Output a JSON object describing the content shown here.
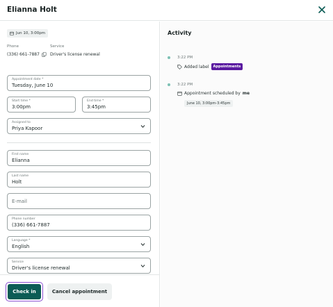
{
  "header": {
    "title": "Elianna Holt"
  },
  "summary": {
    "date_chip": "Jun 10, 3:00pm",
    "phone_label": "Phone",
    "phone_value": "(336) 661-7887",
    "service_label": "Service",
    "service_value": "Driver's license renewal"
  },
  "form": {
    "appointment_date": {
      "label": "Appointment date *",
      "value": "Tuesday, June 10"
    },
    "start_time": {
      "label": "Start time *",
      "value": "3:00pm"
    },
    "end_time": {
      "label": "End time *",
      "value": "3:45pm"
    },
    "assigned_to": {
      "label": "Assigned to",
      "value": "Priya Kapoor"
    },
    "first_name": {
      "label": "First name",
      "value": "Elianna"
    },
    "last_name": {
      "label": "Last name",
      "value": "Holt"
    },
    "email": {
      "placeholder": "E-mail"
    },
    "phone_number": {
      "label": "Phone number",
      "value": "(336) 661-7887"
    },
    "language": {
      "label": "Language *",
      "value": "English"
    },
    "service": {
      "label": "Service",
      "value": "Driver's license renewal"
    }
  },
  "footer": {
    "check_in_label": "Check in",
    "cancel_label": "Cancel appointment"
  },
  "activity": {
    "title": "Activity",
    "items": [
      {
        "time": "3:22 PM",
        "text": "Added label",
        "badge": "Appointments",
        "icon": "tag-icon"
      },
      {
        "time": "3:22 PM",
        "text": "Appointment scheduled by",
        "actor": "me",
        "chip": "June 10, 3:00pm-3:45pm",
        "icon": "calendar-icon"
      }
    ]
  },
  "colors": {
    "primary": "#0b5c55",
    "focus_ring": "#8a4fd1",
    "badge": "#5a1aa0",
    "timeline_dot": "#7cc0b4"
  }
}
